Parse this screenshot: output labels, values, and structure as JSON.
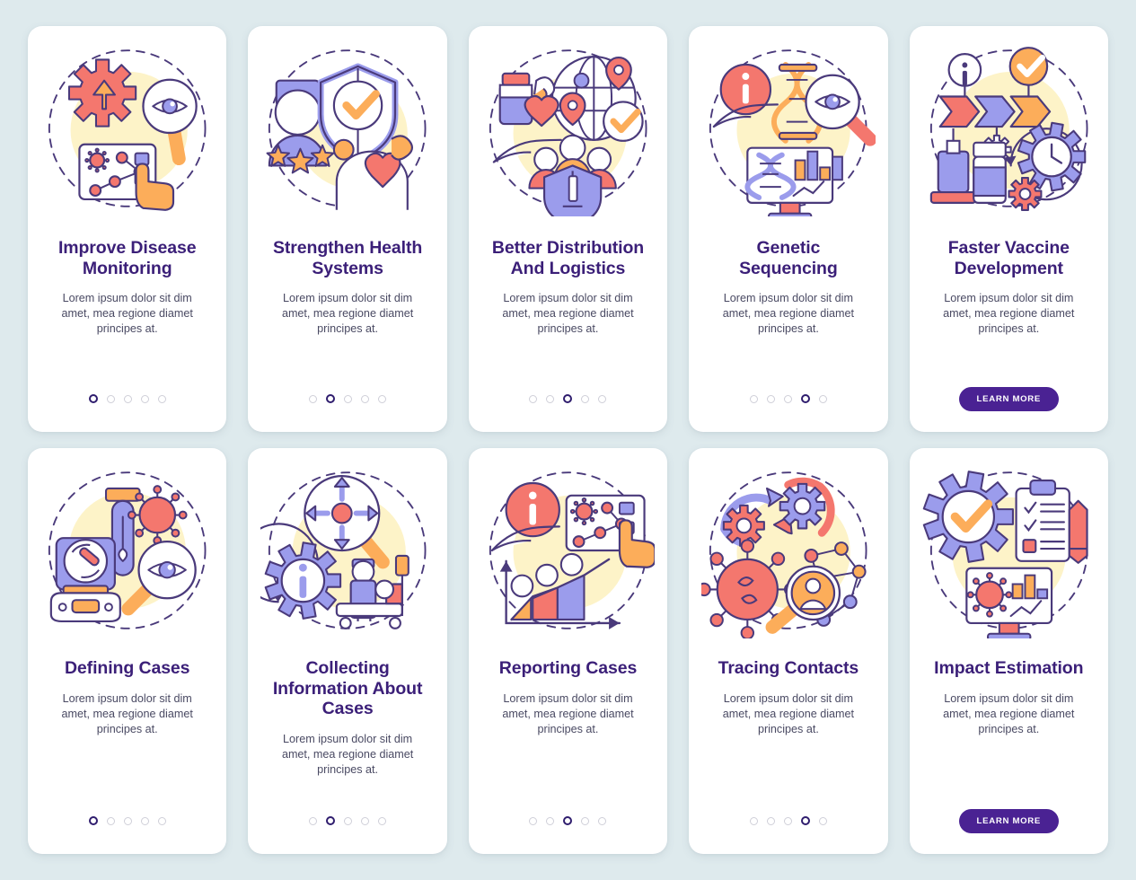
{
  "theme": {
    "background": "#deeaed",
    "card_background": "#ffffff",
    "title_color": "#3b1f78",
    "body_color": "#4a4a63",
    "accent_purple": "#4a2293",
    "dot_active": "#2f1d6e",
    "dot_inactive": "#cfcfd8",
    "illustration_backdrop": "#fdf3c8",
    "coral": "#f4776e",
    "periwinkle": "#9b9cec",
    "orange": "#fcad5a",
    "outline": "#4a3a7b"
  },
  "shared": {
    "description": "Lorem ipsum dolor sit dim amet, mea regione diamet principes at.",
    "learn_more_label": "LEARN MORE",
    "dot_count": 5
  },
  "screens": [
    {
      "id": "improve-disease-monitoring",
      "title": "Improve Disease Monitoring",
      "description": "Lorem ipsum dolor sit dim amet, mea regione diamet principes at.",
      "active_dot": 1,
      "has_learn_more": false,
      "illustration": "gear-arrow-eye-magnifier-network-screen-icon"
    },
    {
      "id": "strengthen-health-systems",
      "title": "Strengthen Health Systems",
      "description": "Lorem ipsum dolor sit dim amet, mea regione diamet principes at.",
      "active_dot": 2,
      "has_learn_more": false,
      "illustration": "doctor-shield-check-heart-stars-icon"
    },
    {
      "id": "better-distribution-and-logistics",
      "title": "Better Distribution And Logistics",
      "description": "Lorem ipsum dolor sit dim amet, mea regione diamet principes at.",
      "active_dot": 3,
      "has_learn_more": false,
      "illustration": "globe-pins-vaccine-people-shield-icon"
    },
    {
      "id": "genetic-sequencing",
      "title": "Genetic Sequencing",
      "description": "Lorem ipsum dolor sit dim amet, mea regione diamet principes at.",
      "active_dot": 4,
      "has_learn_more": false,
      "illustration": "dna-magnifier-eye-monitor-chart-icon"
    },
    {
      "id": "faster-vaccine-development",
      "title": "Faster Vaccine Development",
      "description": "Lorem ipsum dolor sit dim amet, mea regione diamet principes at.",
      "active_dot": 5,
      "has_learn_more": true,
      "illustration": "arrows-timeline-syringe-clock-gear-icon"
    },
    {
      "id": "defining-cases",
      "title": "Defining Cases",
      "description": "Lorem ipsum dolor sit dim amet, mea regione diamet principes at.",
      "active_dot": 1,
      "has_learn_more": false,
      "illustration": "test-tube-virus-microscope-magnifier-icon"
    },
    {
      "id": "collecting-information-about-cases",
      "title": "Collecting Information About Cases",
      "description": "Lorem ipsum dolor sit dim amet, mea regione diamet principes at.",
      "active_dot": 2,
      "has_learn_more": false,
      "illustration": "magnifier-arrows-gear-info-patient-bed-icon"
    },
    {
      "id": "reporting-cases",
      "title": "Reporting Cases",
      "description": "Lorem ipsum dolor sit dim amet, mea regione diamet principes at.",
      "active_dot": 3,
      "has_learn_more": false,
      "illustration": "info-hand-screen-network-people-graph-icon"
    },
    {
      "id": "tracing-contacts",
      "title": "Tracing Contacts",
      "description": "Lorem ipsum dolor sit dim amet, mea regione diamet principes at.",
      "active_dot": 4,
      "has_learn_more": false,
      "illustration": "cycle-gears-virus-magnifier-person-network-icon"
    },
    {
      "id": "impact-estimation",
      "title": "Impact Estimation",
      "description": "Lorem ipsum dolor sit dim amet, mea regione diamet principes at.",
      "active_dot": 5,
      "has_learn_more": true,
      "illustration": "gear-check-clipboard-pencil-monitor-chart-icon"
    }
  ]
}
